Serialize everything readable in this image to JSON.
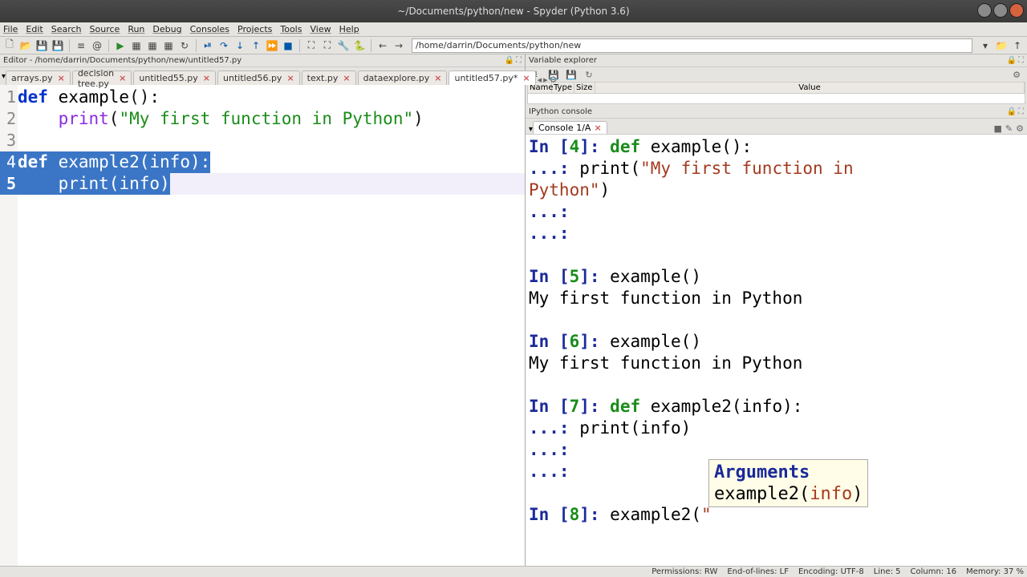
{
  "titlebar": {
    "title": "~/Documents/python/new - Spyder (Python 3.6)"
  },
  "menubar": [
    "File",
    "Edit",
    "Search",
    "Source",
    "Run",
    "Debug",
    "Consoles",
    "Projects",
    "Tools",
    "View",
    "Help"
  ],
  "toolbar_path": "/home/darrin/Documents/python/new",
  "editor_path_bar": "Editor - /home/darrin/Documents/python/new/untitled57.py",
  "tabs": [
    {
      "label": "arrays.py",
      "active": false
    },
    {
      "label": "decision tree.py",
      "active": false
    },
    {
      "label": "untitled55.py",
      "active": false
    },
    {
      "label": "untitled56.py",
      "active": false
    },
    {
      "label": "text.py",
      "active": false
    },
    {
      "label": "dataexplore.py",
      "active": false
    },
    {
      "label": "untitled57.py*",
      "active": true
    }
  ],
  "code_lines": {
    "l1_def": "def ",
    "l1_fn": "example",
    "l1_paren": "():",
    "l2_indent": "    ",
    "l2_print": "print",
    "l2_open": "(",
    "l2_str": "\"My first function in Python\"",
    "l2_close": ")",
    "l4_def": "def ",
    "l4_fn": "example2",
    "l4_open": "(",
    "l4_arg": "info",
    "l4_close": "):",
    "l5_indent": "    ",
    "l5_print": "print",
    "l5_open": "(",
    "l5_arg": "info",
    "l5_close": ")"
  },
  "var_explorer": {
    "title": "Variable explorer",
    "cols": [
      "Name",
      "Type",
      "Size",
      "Value"
    ]
  },
  "ipython": {
    "title": "IPython console",
    "tab": "Console 1/A",
    "in4_prefix": "In [",
    "in4_num": "4",
    "in4_suffix": "]: ",
    "def": "def ",
    "example_fn": "example",
    "example_paren": "():",
    "cont": "   ...: ",
    "indent": "    ",
    "print_call": "print",
    "popen": "(",
    "pclose": ")",
    "str1": "\"My first function in ",
    "str1b": "Python\"",
    "in5_num": "5",
    "call5": "example()",
    "out5": "My first function in Python",
    "in6_num": "6",
    "call6": "example()",
    "out6": "My first function in Python",
    "in7_num": "7",
    "example2_fn": "example2",
    "ex2_open": "(",
    "ex2_arg": "info",
    "ex2_close": "):",
    "in8_num": "8",
    "call8_fn": "example2(",
    "call8_q": "\"",
    "tooltip": {
      "title": "Arguments",
      "sig_fn": "example2(",
      "sig_arg": "info",
      "sig_close": ")"
    }
  },
  "statusbar": {
    "perm": "Permissions: RW",
    "eol": "End-of-lines: LF",
    "enc": "Encoding: UTF-8",
    "line": "Line: 5",
    "col": "Column: 16",
    "mem": "Memory: 37 %"
  }
}
